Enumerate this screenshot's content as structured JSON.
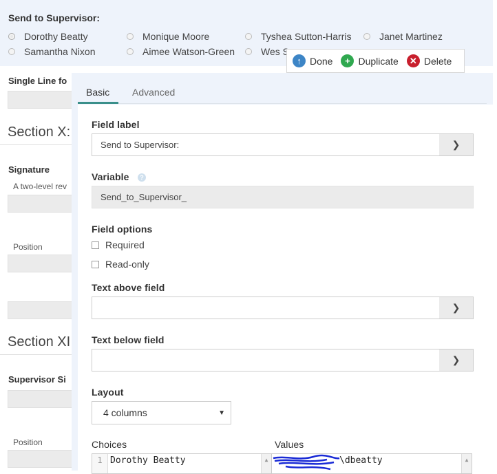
{
  "question": {
    "title": "Send to Supervisor:",
    "options": [
      "Dorothy Beatty",
      "Monique Moore",
      "Tyshea Sutton-Harris",
      "Janet Martinez",
      "Samantha Nixon",
      "Aimee Watson-Green",
      "Wes S"
    ]
  },
  "background_form": {
    "single_line_label": "Single Line fo",
    "section_x": "Section X:",
    "signature_label": "Signature",
    "signature_desc": "A two-level rev",
    "position_label_1": "Position",
    "section_xi": "Section XI",
    "supervisor_sig_label": "Supervisor Si",
    "position_label_2": "Position"
  },
  "toolbar": {
    "done": "Done",
    "duplicate": "Duplicate",
    "delete": "Delete"
  },
  "tabs": [
    "Basic",
    "Advanced"
  ],
  "fields": {
    "field_label": {
      "label": "Field label",
      "value": "Send to Supervisor:"
    },
    "variable": {
      "label": "Variable",
      "value": "Send_to_Supervisor_"
    },
    "field_options": {
      "label": "Field options",
      "required": "Required",
      "read_only": "Read-only"
    },
    "text_above": {
      "label": "Text above field",
      "value": ""
    },
    "text_below": {
      "label": "Text below field",
      "value": ""
    },
    "layout": {
      "label": "Layout",
      "value": "4 columns"
    },
    "choices": {
      "label": "Choices",
      "line_number": "1",
      "first": "Dorothy Beatty"
    },
    "values": {
      "label": "Values",
      "first": "\\dbeatty"
    }
  },
  "icons": {
    "done": "arrow-up-circle-icon",
    "duplicate": "plus-circle-icon",
    "delete": "x-circle-icon",
    "addon": "chevron-right-icon",
    "help": "question-circle-icon"
  },
  "colors": {
    "done": "#3d85c6",
    "duplicate": "#2fa84f",
    "delete": "#c81f2d",
    "tab_accent": "#3a8f8a",
    "panel_bg": "#eef3fb"
  }
}
